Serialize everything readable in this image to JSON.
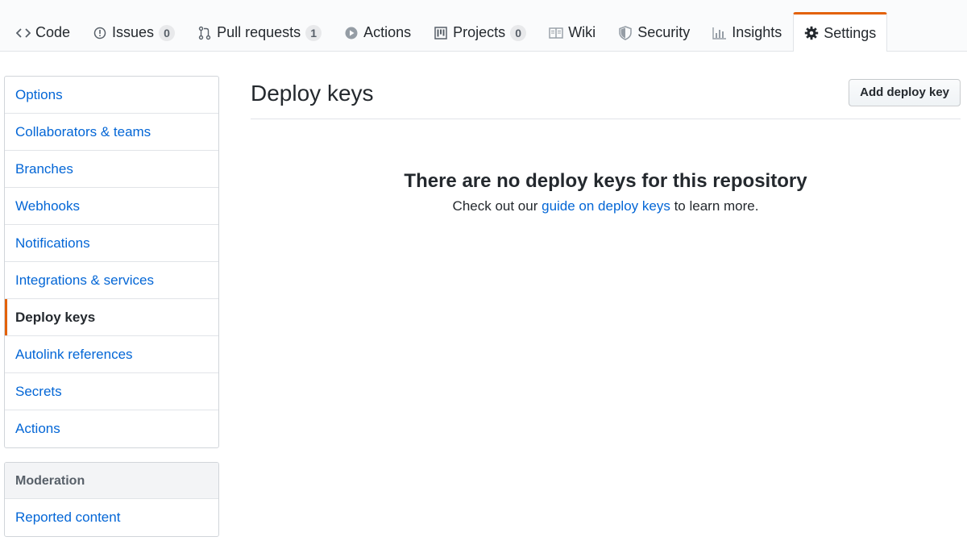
{
  "repo_nav": {
    "tabs": [
      {
        "label": "Code",
        "icon": "code-icon",
        "counter": null
      },
      {
        "label": "Issues",
        "icon": "issue-icon",
        "counter": "0"
      },
      {
        "label": "Pull requests",
        "icon": "pull-request-icon",
        "counter": "1"
      },
      {
        "label": "Actions",
        "icon": "play-icon",
        "counter": null
      },
      {
        "label": "Projects",
        "icon": "project-icon",
        "counter": "0"
      },
      {
        "label": "Wiki",
        "icon": "book-icon",
        "counter": null
      },
      {
        "label": "Security",
        "icon": "shield-icon",
        "counter": null
      },
      {
        "label": "Insights",
        "icon": "graph-icon",
        "counter": null
      },
      {
        "label": "Settings",
        "icon": "gear-icon",
        "counter": null,
        "selected": true
      }
    ]
  },
  "sidebar": {
    "items": [
      {
        "label": "Options"
      },
      {
        "label": "Collaborators & teams"
      },
      {
        "label": "Branches"
      },
      {
        "label": "Webhooks"
      },
      {
        "label": "Notifications"
      },
      {
        "label": "Integrations & services"
      },
      {
        "label": "Deploy keys",
        "selected": true
      },
      {
        "label": "Autolink references"
      },
      {
        "label": "Secrets"
      },
      {
        "label": "Actions"
      }
    ],
    "moderation": {
      "heading": "Moderation",
      "items": [
        {
          "label": "Reported content"
        }
      ]
    }
  },
  "main": {
    "title": "Deploy keys",
    "add_button_label": "Add deploy key",
    "blankslate": {
      "heading": "There are no deploy keys for this repository",
      "text_before": "Check out our ",
      "link_text": "guide on deploy keys",
      "text_after": " to learn more."
    }
  },
  "colors": {
    "accent": "#e36209",
    "link": "#0366d6",
    "text": "#24292e",
    "muted": "#586069",
    "border": "#e1e4e8"
  }
}
